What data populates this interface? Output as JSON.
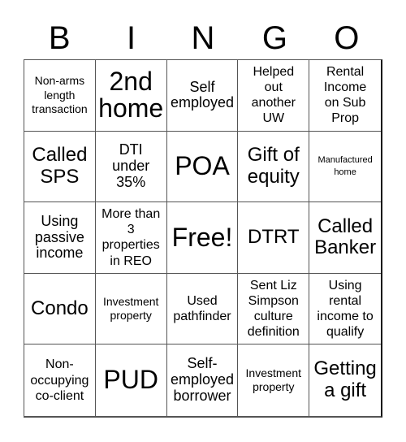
{
  "title_letters": [
    "B",
    "I",
    "N",
    "G",
    "O"
  ],
  "cells": [
    {
      "text": "Non-arms\nlength\ntransaction",
      "size": "s-xs"
    },
    {
      "text": "2nd\nhome",
      "size": "s-xl"
    },
    {
      "text": "Self\nemployed",
      "size": "s-md"
    },
    {
      "text": "Helped\nout\nanother\nUW",
      "size": "s-sm"
    },
    {
      "text": "Rental\nIncome\non Sub\nProp",
      "size": "s-sm"
    },
    {
      "text": "Called\nSPS",
      "size": "s-lg"
    },
    {
      "text": "DTI\nunder\n35%",
      "size": "s-md"
    },
    {
      "text": "POA",
      "size": "s-xl"
    },
    {
      "text": "Gift of\nequity",
      "size": "s-lg"
    },
    {
      "text": "Manufactured\nhome",
      "size": "s-xxs"
    },
    {
      "text": "Using\npassive\nincome",
      "size": "s-md"
    },
    {
      "text": "More than\n3\nproperties\nin REO",
      "size": "s-sm"
    },
    {
      "text": "Free!",
      "size": "s-xl"
    },
    {
      "text": "DTRT",
      "size": "s-lg"
    },
    {
      "text": "Called\nBanker",
      "size": "s-lg"
    },
    {
      "text": "Condo",
      "size": "s-lg"
    },
    {
      "text": "Investment\nproperty",
      "size": "s-xs"
    },
    {
      "text": "Used\npathfinder",
      "size": "s-sm"
    },
    {
      "text": "Sent Liz\nSimpson\nculture\ndefinition",
      "size": "s-sm"
    },
    {
      "text": "Using\nrental\nincome to\nqualify",
      "size": "s-sm"
    },
    {
      "text": "Non-\noccupying\nco-client",
      "size": "s-sm"
    },
    {
      "text": "PUD",
      "size": "s-xl"
    },
    {
      "text": "Self-\nemployed\nborrower",
      "size": "s-md"
    },
    {
      "text": "Investment\nproperty",
      "size": "s-xs"
    },
    {
      "text": "Getting\na gift",
      "size": "s-lg"
    }
  ]
}
